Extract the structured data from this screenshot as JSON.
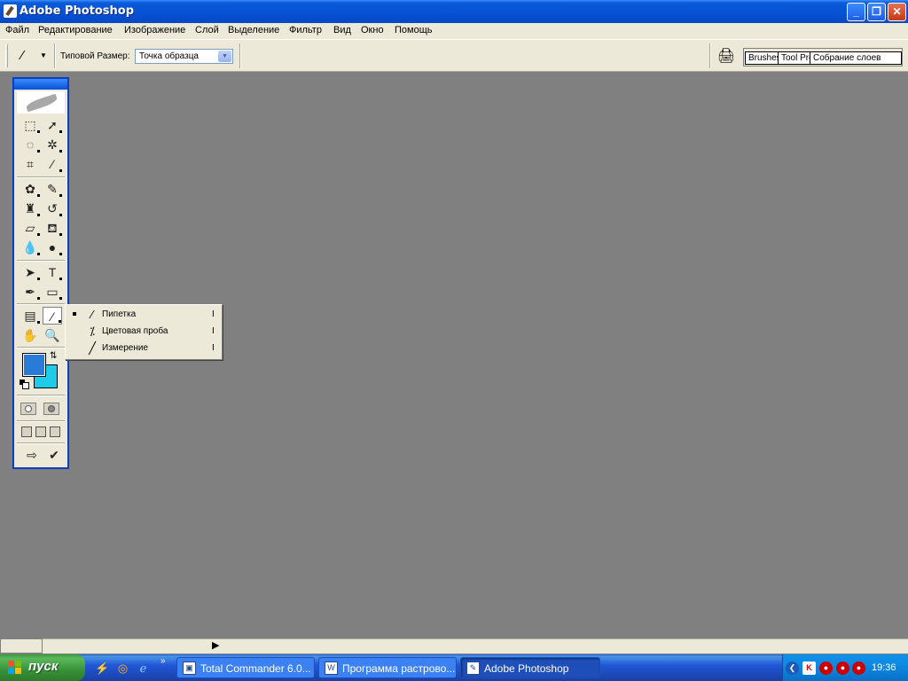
{
  "window": {
    "title": "Adobe Photoshop",
    "min": "_",
    "max": "❐",
    "close": "✕"
  },
  "menu": [
    "Файл",
    "Редактирование",
    "Изображение",
    "Слой",
    "Выделение",
    "Фильтр",
    "Вид",
    "Окно",
    "Помощь"
  ],
  "options": {
    "sample_size_label": "Типовой Размер:",
    "sample_size_value": "Точка образца",
    "tabs": [
      "Brushes",
      "Tool Presets",
      "Собрание слоев"
    ]
  },
  "flyout": {
    "items": [
      {
        "label": "Пипетка",
        "key": "I",
        "selected": true,
        "icon": "eyedropper-icon"
      },
      {
        "label": "Цветовая проба",
        "key": "I",
        "selected": false,
        "icon": "color-sampler-icon"
      },
      {
        "label": "Измерение",
        "key": "I",
        "selected": false,
        "icon": "measure-icon"
      }
    ]
  },
  "colors": {
    "foreground": "#2a7bd8",
    "background": "#1ecbe8",
    "titlebar": "#0751d6",
    "canvas": "#808080"
  },
  "taskbar": {
    "start_label": "пуск",
    "tasks": [
      {
        "label": "Total Commander 6.0...",
        "icon": "floppy-icon"
      },
      {
        "label": "Программа растрово...",
        "icon": "word-icon"
      },
      {
        "label": "Adobe Photoshop",
        "icon": "photoshop-icon"
      }
    ],
    "clock": "19:36"
  }
}
